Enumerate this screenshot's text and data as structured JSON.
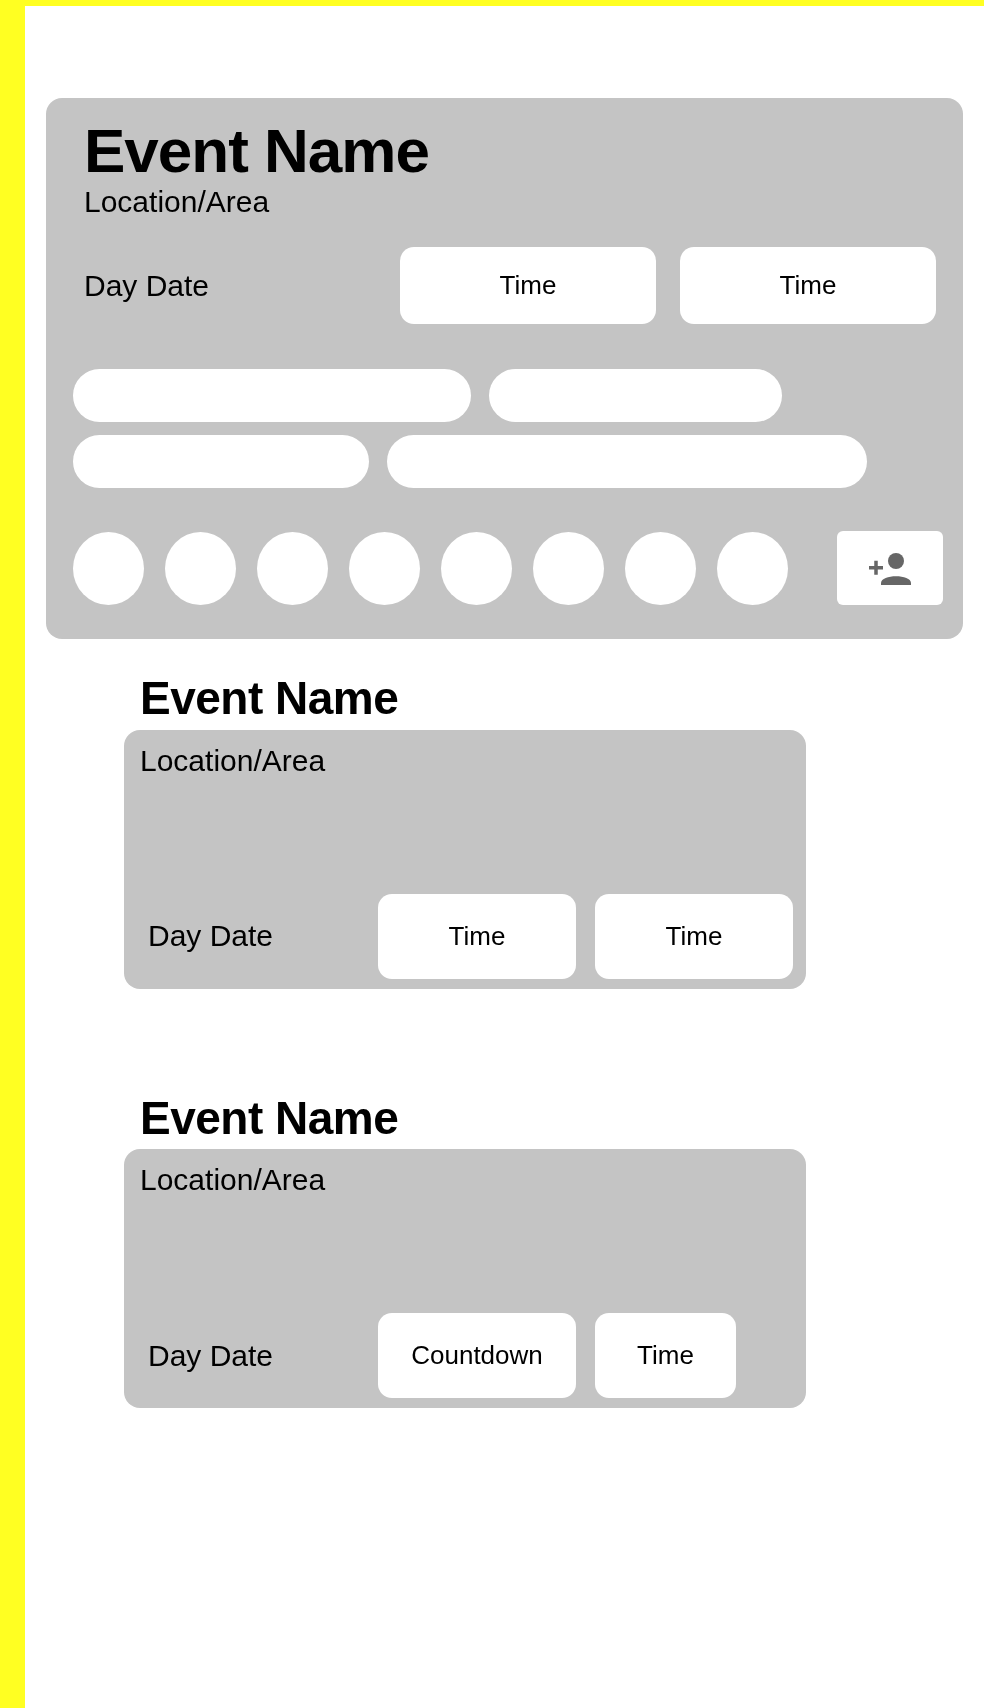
{
  "events": [
    {
      "kind": "expanded",
      "title": "Event Name",
      "location": "Location/Area",
      "date": "Day Date",
      "buttons": [
        {
          "label": "Time",
          "kind": "wide"
        },
        {
          "label": "Time",
          "kind": "wide"
        }
      ]
    },
    {
      "kind": "compact",
      "title": "Event Name",
      "location": "Location/Area",
      "date": "Day Date",
      "buttons": [
        {
          "label": "Time",
          "kind": "wide"
        },
        {
          "label": "Time",
          "kind": "wide"
        }
      ]
    },
    {
      "kind": "compact",
      "title": "Event Name",
      "location": "Location/Area",
      "date": "Day Date",
      "buttons": [
        {
          "label": "Countdown",
          "kind": "wide"
        },
        {
          "label": "Time",
          "kind": "narrow"
        }
      ]
    }
  ]
}
